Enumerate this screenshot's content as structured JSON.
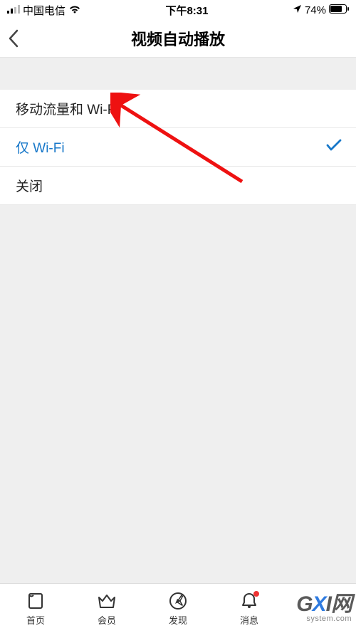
{
  "statusBar": {
    "carrier": "中国电信",
    "time": "下午8:31",
    "battery": "74%"
  },
  "nav": {
    "title": "视频自动播放"
  },
  "options": [
    {
      "label": "移动流量和 Wi-Fi",
      "selected": false
    },
    {
      "label": "仅 Wi-Fi",
      "selected": true
    },
    {
      "label": "关闭",
      "selected": false
    }
  ],
  "tabs": [
    {
      "label": "首页",
      "icon": "home-icon"
    },
    {
      "label": "会员",
      "icon": "crown-icon"
    },
    {
      "label": "发现",
      "icon": "compass-icon"
    },
    {
      "label": "消息",
      "icon": "bell-icon"
    }
  ],
  "watermark": {
    "brand_prefix": "G",
    "brand_x": "X",
    "brand_suffix": "I网",
    "url": "system.com"
  },
  "annotation": {
    "arrow_target": "移动流量和 Wi-Fi"
  }
}
